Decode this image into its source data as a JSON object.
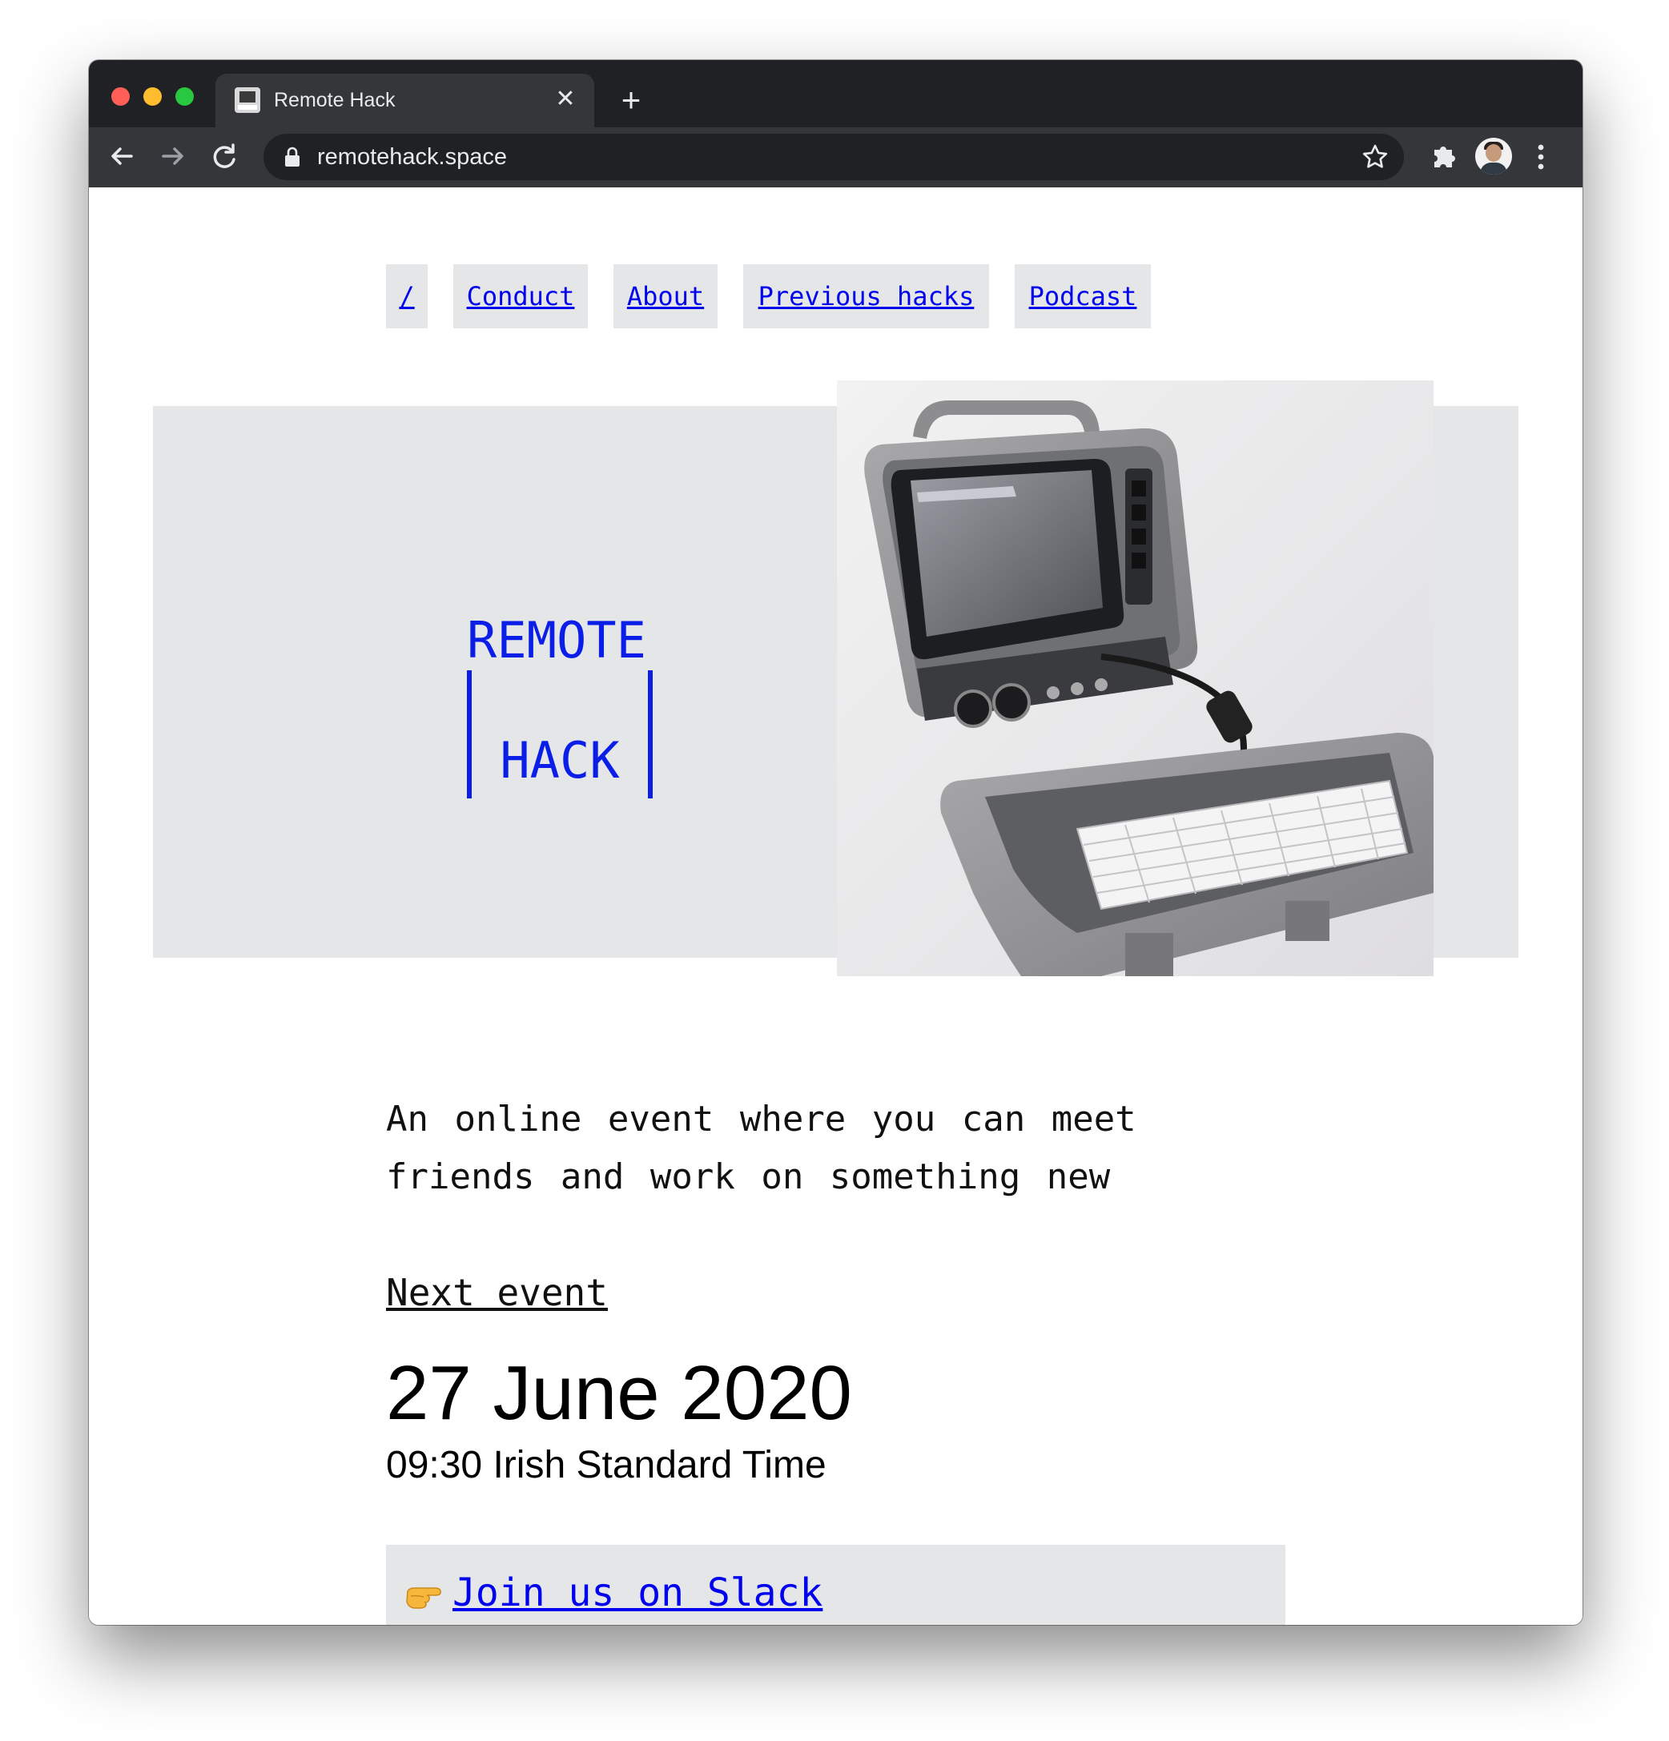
{
  "browser": {
    "tab_title": "Remote Hack",
    "url": "remotehack.space",
    "traffic_colors": {
      "close": "#ff5f57",
      "minimize": "#febc2e",
      "zoom": "#28c840"
    }
  },
  "nav": {
    "items": [
      {
        "label": "/"
      },
      {
        "label": "Conduct"
      },
      {
        "label": "About"
      },
      {
        "label": "Previous hacks"
      },
      {
        "label": "Podcast"
      }
    ]
  },
  "hero": {
    "logo_top": "REMOTE",
    "logo_bottom": "HACK",
    "logo_color": "#0a1ee8",
    "image_icon": "portable-computer-image"
  },
  "main": {
    "tagline": "An online event where you can meet friends and work on something new",
    "next_event_label": "Next event",
    "event_date": "27 June 2020",
    "event_time": "09:30 Irish Standard Time",
    "slack_cta": "Join us on Slack",
    "slack_icon": "pointing-hand-icon"
  },
  "colors": {
    "link": "#0000ee",
    "panel": "#e5e6e8",
    "chrome_dark": "#202124",
    "chrome_toolbar": "#35363a"
  }
}
